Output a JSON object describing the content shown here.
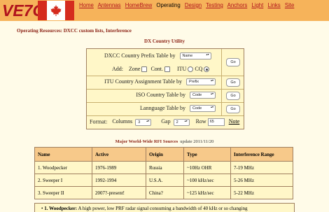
{
  "header": {
    "logo": "VE7CA",
    "nav": [
      {
        "label": "Home",
        "current": false
      },
      {
        "label": "Antennas",
        "current": false
      },
      {
        "label": "HomeBrew",
        "current": false
      },
      {
        "label": "Operating",
        "current": true
      },
      {
        "label": "Design",
        "current": false
      },
      {
        "label": "Testing",
        "current": false
      },
      {
        "label": "Anchors",
        "current": false
      },
      {
        "label": "Light",
        "current": false
      },
      {
        "label": "Links",
        "current": false
      },
      {
        "label": "Site",
        "current": false
      }
    ]
  },
  "resources_title": "Operating Resources: DXCC custom lists, Interference",
  "utility": {
    "title": "DX Country Utility",
    "prefix_label": "DXCC Country Prefix Table by",
    "prefix_select": "Name",
    "add_label": "Add:",
    "zone_label": "Zone",
    "cont_label": "Cont.",
    "itu_label": "ITU",
    "cq_label": "CQ",
    "itu_table_label": "ITU Country Assignment Table by",
    "itu_select": "Prefix",
    "iso_label": "ISO Country Table by",
    "iso_select": "Code",
    "lang_label": "Lannguage Table by",
    "lang_select": "Code",
    "format_label": "Format:",
    "columns_label": "Columns",
    "columns_value": "3",
    "gap_label": "Gap",
    "gap_value": "2",
    "row_label": "Row",
    "row_value": "65",
    "note_label": "Note",
    "go_label": "Go"
  },
  "rfi": {
    "title": "Major World-Wide RFI Sources",
    "update": "update 2011/11/20",
    "columns": [
      "Name",
      "Active",
      "Origin",
      "Type",
      "Interference Range"
    ],
    "rows": [
      [
        "1. Woodpecker",
        "1976-1989",
        "Russia",
        "~10Hz OHR",
        "7-19 MHz"
      ],
      [
        "2. Sweeper I",
        "1992-1994",
        "U.S.A.",
        "~100 kHz/sec",
        "5-26 MHz"
      ],
      [
        "3. Sweeper II",
        "2007?-present!",
        "China?",
        "~125 kHz/sec",
        "5-22 MHz"
      ]
    ],
    "desc_name": "1. Woodpecker:",
    "desc_text": " A high power, low PRF radar signal consuming a bandwidth of 40 kHz or so changing"
  }
}
